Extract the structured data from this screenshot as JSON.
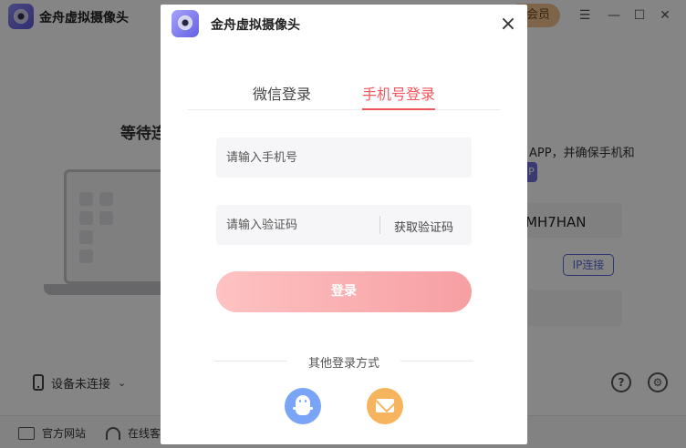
{
  "app": {
    "title": "金舟虚拟摄像头",
    "vip_label": "会员",
    "wait_title": "等待连",
    "hint_text": "APP，并确保手机和",
    "ap_badge": "P",
    "connection_code": "MH7HAN",
    "ip_connect_label": "IP连接",
    "device_status": "设备未连接",
    "help_glyph": "?",
    "footer": {
      "website_label": "官方网站",
      "service_label": "在线客"
    }
  },
  "dialog": {
    "title": "金舟虚拟摄像头",
    "close_glyph": "×",
    "tabs": [
      {
        "label": "微信登录",
        "active": false
      },
      {
        "label": "手机号登录",
        "active": true
      }
    ],
    "phone_placeholder": "请输入手机号",
    "code_placeholder": "请输入验证码",
    "get_code_label": "获取验证码",
    "login_label": "登录",
    "other_methods_label": "其他登录方式",
    "social": [
      {
        "name": "qq-icon",
        "color": "#7aa4f5"
      },
      {
        "name": "mail-icon",
        "color": "#f7b45f"
      }
    ]
  },
  "colors": {
    "accent": "#f0565c",
    "login_gradient_start": "#fec2c2",
    "login_gradient_end": "#f69fa3",
    "brand_purple": "#6360e4"
  }
}
